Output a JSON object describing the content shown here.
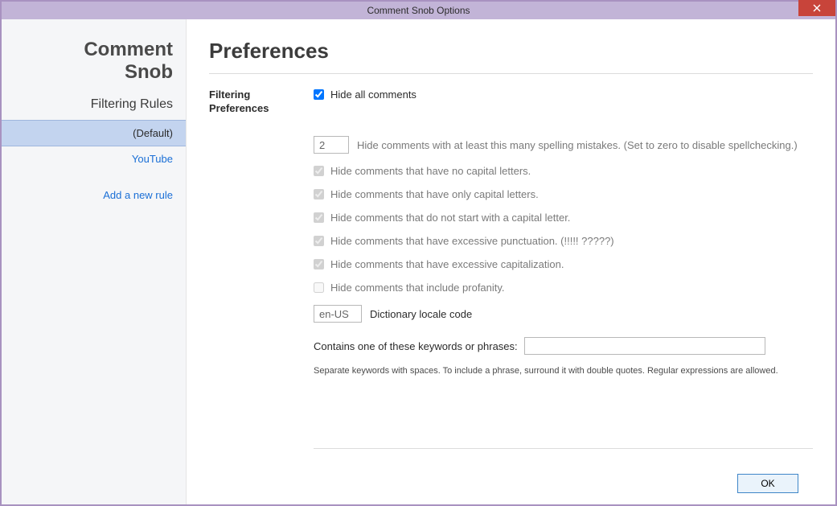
{
  "window": {
    "title": "Comment Snob Options"
  },
  "sidebar": {
    "app_name_line1": "Comment",
    "app_name_line2": "Snob",
    "section": "Filtering Rules",
    "items": [
      {
        "label": "(Default)",
        "selected": true
      },
      {
        "label": "YouTube",
        "selected": false
      }
    ],
    "add_rule": "Add a new rule"
  },
  "main": {
    "heading": "Preferences",
    "section_label_line1": "Filtering",
    "section_label_line2": "Preferences",
    "hide_all": {
      "label": "Hide all comments",
      "checked": true
    },
    "spellcheck": {
      "value": "2",
      "label": "Hide comments with at least this many spelling mistakes. (Set to zero to disable spellchecking.)"
    },
    "no_caps": {
      "label": "Hide comments that have no capital letters.",
      "checked": true
    },
    "only_caps": {
      "label": "Hide comments that have only capital letters.",
      "checked": true
    },
    "no_start_cap": {
      "label": "Hide comments that do not start with a capital letter.",
      "checked": true
    },
    "punct": {
      "label": "Hide comments that have excessive punctuation. (!!!!! ?????)",
      "checked": true
    },
    "excess_caps": {
      "label": "Hide comments that have excessive capitalization.",
      "checked": true
    },
    "profanity": {
      "label": "Hide comments that include profanity.",
      "checked": false
    },
    "locale": {
      "value": "en-US",
      "label": "Dictionary locale code"
    },
    "keywords": {
      "label": "Contains one of these keywords or phrases:",
      "value": ""
    },
    "help": "Separate keywords with spaces. To include a phrase, surround it with double quotes. Regular expressions are allowed."
  },
  "footer": {
    "ok": "OK"
  }
}
